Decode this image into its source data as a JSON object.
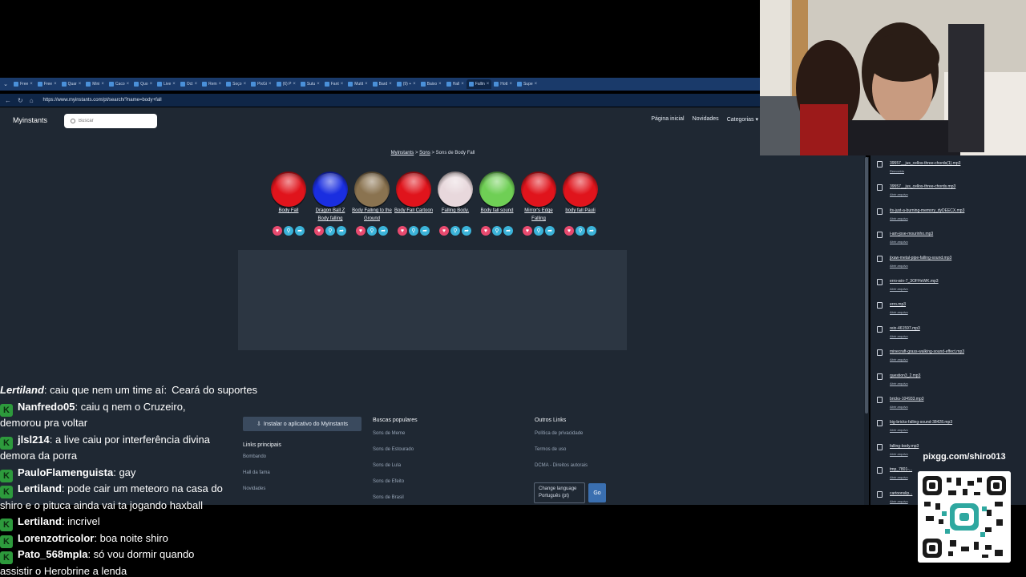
{
  "browser": {
    "tabs": [
      {
        "label": "Free"
      },
      {
        "label": "Free"
      },
      {
        "label": "Quar"
      },
      {
        "label": "Mini"
      },
      {
        "label": "Caco"
      },
      {
        "label": "Quo"
      },
      {
        "label": "Live"
      },
      {
        "label": "Oct"
      },
      {
        "label": "Rem"
      },
      {
        "label": "Soço"
      },
      {
        "label": "PixGi"
      },
      {
        "label": "(6) P"
      },
      {
        "label": "Sutu"
      },
      {
        "label": "Fant"
      },
      {
        "label": "Mutit"
      },
      {
        "label": "Bard"
      },
      {
        "label": "(9) +"
      },
      {
        "label": "Baixo"
      },
      {
        "label": "Hall"
      },
      {
        "label": "Fallin"
      },
      {
        "label": "Hott"
      },
      {
        "label": "Supe"
      }
    ],
    "url": "https://www.myinstants.com/pt/search/?name=body+fall"
  },
  "site": {
    "brand": "Myinstants",
    "search_placeholder": "Buscar",
    "nav": {
      "home": "Página inicial",
      "news": "Novidades",
      "categories": "Categorias ▾"
    },
    "breadcrumb": {
      "root": "Myinstants",
      "sep1": " > ",
      "sons": "Sons",
      "sep2": " > ",
      "current": "Sons de Body Fall"
    },
    "buttons": [
      {
        "label": "Body Fall",
        "color": "#e0141c"
      },
      {
        "label": "Dragon Ball Z Body falling",
        "color": "#1a2ee0"
      },
      {
        "label": "Body Falling to the Ground",
        "color": "#8a7350"
      },
      {
        "label": "Body Fall Cartoon",
        "color": "#e0141c"
      },
      {
        "label": "Falling Body.",
        "color": "#e8d8dc"
      },
      {
        "label": "Body fall sound",
        "color": "#6fcf55"
      },
      {
        "label": "Mirror's Edge Falling",
        "color": "#e0141c"
      },
      {
        "label": "body fall Pauli",
        "color": "#e0141c"
      }
    ],
    "install_label": "Instalar o aplicativo do Myinstants",
    "footer": {
      "popular_title": "Buscas populares",
      "popular": [
        "Sons de Meme",
        "Sons de Estourado",
        "Sons de Lula",
        "Sons de Efeito",
        "Sons de Brasil"
      ],
      "main_links_title": "Links principais",
      "main_links": [
        "Bombando",
        "Hall da fama",
        "Novidades"
      ],
      "other_title": "Outros Links",
      "other": [
        "Política de privacidade",
        "Termos de uso",
        "DCMA - Direitos autorais"
      ],
      "lang_label": "Change language",
      "lang_value": "Português (pt)",
      "go": "Go"
    }
  },
  "downloads": [
    {
      "name": "39557__jus_cellos-three-chords(1).mp3",
      "status": "Removido"
    },
    {
      "name": "39557__jus_cellos-three-chords.mp3",
      "status": "Abrir arquivo"
    },
    {
      "name": "its-just-a-burning-memory_dyDEECX.mp3",
      "status": "Abrir arquivo"
    },
    {
      "name": "i-am-jose-mourinho.mp3",
      "status": "Abrir arquivo"
    },
    {
      "name": "jixaw-metal-pipe-falling-sound.mp3",
      "status": "Abrir arquivo"
    },
    {
      "name": "erro-win-7_3OFHeWK.mp3",
      "status": "Abrir arquivo"
    },
    {
      "name": "erro.mp3",
      "status": "Abrir arquivo"
    },
    {
      "name": "rein-461597.mp3",
      "status": "Abrir arquivo"
    },
    {
      "name": "minecraft-grass-walking-sound-effect.mp3",
      "status": "Abrir arquivo"
    },
    {
      "name": "question3_2.mp3",
      "status": "Abrir arquivo"
    },
    {
      "name": "bricks-104933.mp3",
      "status": "Abrir arquivo"
    },
    {
      "name": "big-bricks-falling-sound-38428.mp3",
      "status": "Abrir arquivo"
    },
    {
      "name": "falling-body.mp3",
      "status": "Abrir arquivo"
    },
    {
      "name": "tmp_7801-...",
      "status": "Abrir arquivo"
    },
    {
      "name": "cartoonslip...",
      "status": "Abrir arquivo"
    }
  ],
  "chat": [
    {
      "user": "Lertiland",
      "text": "caiu que nem um time aí:",
      "extra": "Ceará do suportes",
      "badge": false
    },
    {
      "user": "Nanfredo05",
      "text": "caiu q nem o Cruzeiro,",
      "extra": "demorou pra voltar",
      "badge": true
    },
    {
      "user": "jlsl214",
      "text": "a live caiu por interferência divina",
      "extra": "demora da porra",
      "badge": true
    },
    {
      "user": "PauloFlamenguista",
      "text": "gay",
      "extra": "",
      "badge": true
    },
    {
      "user": "Lertiland",
      "text": "pode cair um meteoro na casa do",
      "extra": "shiro e o pituca ainda vai ta jogando haxball",
      "badge": true
    },
    {
      "user": "Lertiland",
      "text": "incrivel",
      "extra": "",
      "badge": true
    },
    {
      "user": "Lorenzotricolor",
      "text": "boa noite shiro",
      "extra": "",
      "badge": true
    },
    {
      "user": "Pato_568mpla",
      "text": "só vou dormir quando",
      "extra": "assistir o Herobrine a lenda",
      "badge": true
    }
  ],
  "qr": {
    "label": "pixgg.com/shiro013"
  }
}
